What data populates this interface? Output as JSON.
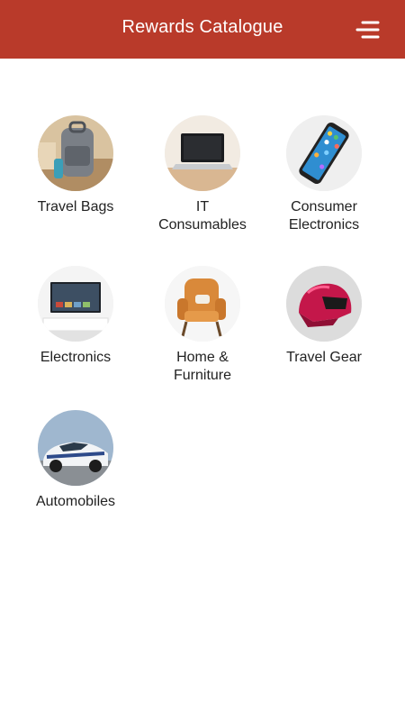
{
  "header": {
    "title": "Rewards Catalogue",
    "menu_icon": "menu-icon"
  },
  "categories": [
    {
      "label": "Travel Bags",
      "image": "backpack"
    },
    {
      "label": "IT\nConsumables",
      "image": "laptop"
    },
    {
      "label": "Consumer\nElectronics",
      "image": "smartphone"
    },
    {
      "label": "Electronics",
      "image": "television"
    },
    {
      "label": "Home &\nFurniture",
      "image": "armchair"
    },
    {
      "label": "Travel Gear",
      "image": "motorcycle-helmet"
    },
    {
      "label": "Automobiles",
      "image": "sports-car"
    }
  ],
  "colors": {
    "header": "#b93a2a",
    "header_text": "#ffffff",
    "background": "#ffffff",
    "label_text": "#222222"
  }
}
